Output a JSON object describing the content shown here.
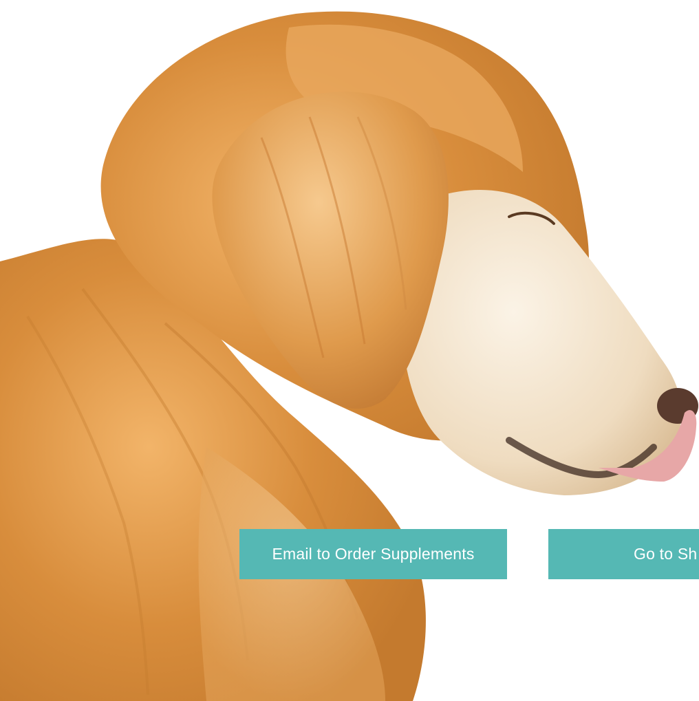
{
  "hero": {
    "image_icon": "golden-retriever-photo",
    "accent_color": "#55b8b4"
  },
  "actions": {
    "email_label": "Email to Order Supplements",
    "shop_label": "Go to Sh"
  }
}
